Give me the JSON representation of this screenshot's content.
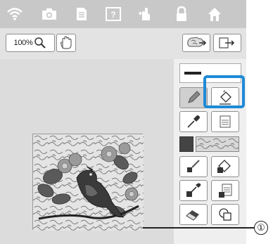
{
  "status_bar": {
    "icons": [
      "wifi-icon",
      "camera-icon",
      "document-icon",
      "help-icon",
      "hand-arrow-icon",
      "lock-icon",
      "home-icon"
    ]
  },
  "toolbar": {
    "zoom_label": "100%",
    "icons": [
      "zoom-magnifier-icon",
      "hand-pan-icon",
      "import-icon",
      "export-icon"
    ]
  },
  "panel": {
    "line_preview": "line-style-preview",
    "fill_pattern": "stippling-pattern",
    "tools": [
      "pencil-tool",
      "fill-bucket-tool",
      "line-eyedropper-tool",
      "fill-eyedropper-tool",
      "line-color-fill-tool",
      "area-fill-tool",
      "line-color-eyedropper-tool",
      "area-eyedropper-tool",
      "eraser-tool",
      "select-shape-tool"
    ]
  },
  "callout": {
    "label": "①"
  },
  "colors": {
    "accent": "#1e8ad6",
    "status_bar_bg": "#c8c8c8",
    "canvas_bg": "#dcdcdc",
    "panel_bg": "#efefef"
  }
}
